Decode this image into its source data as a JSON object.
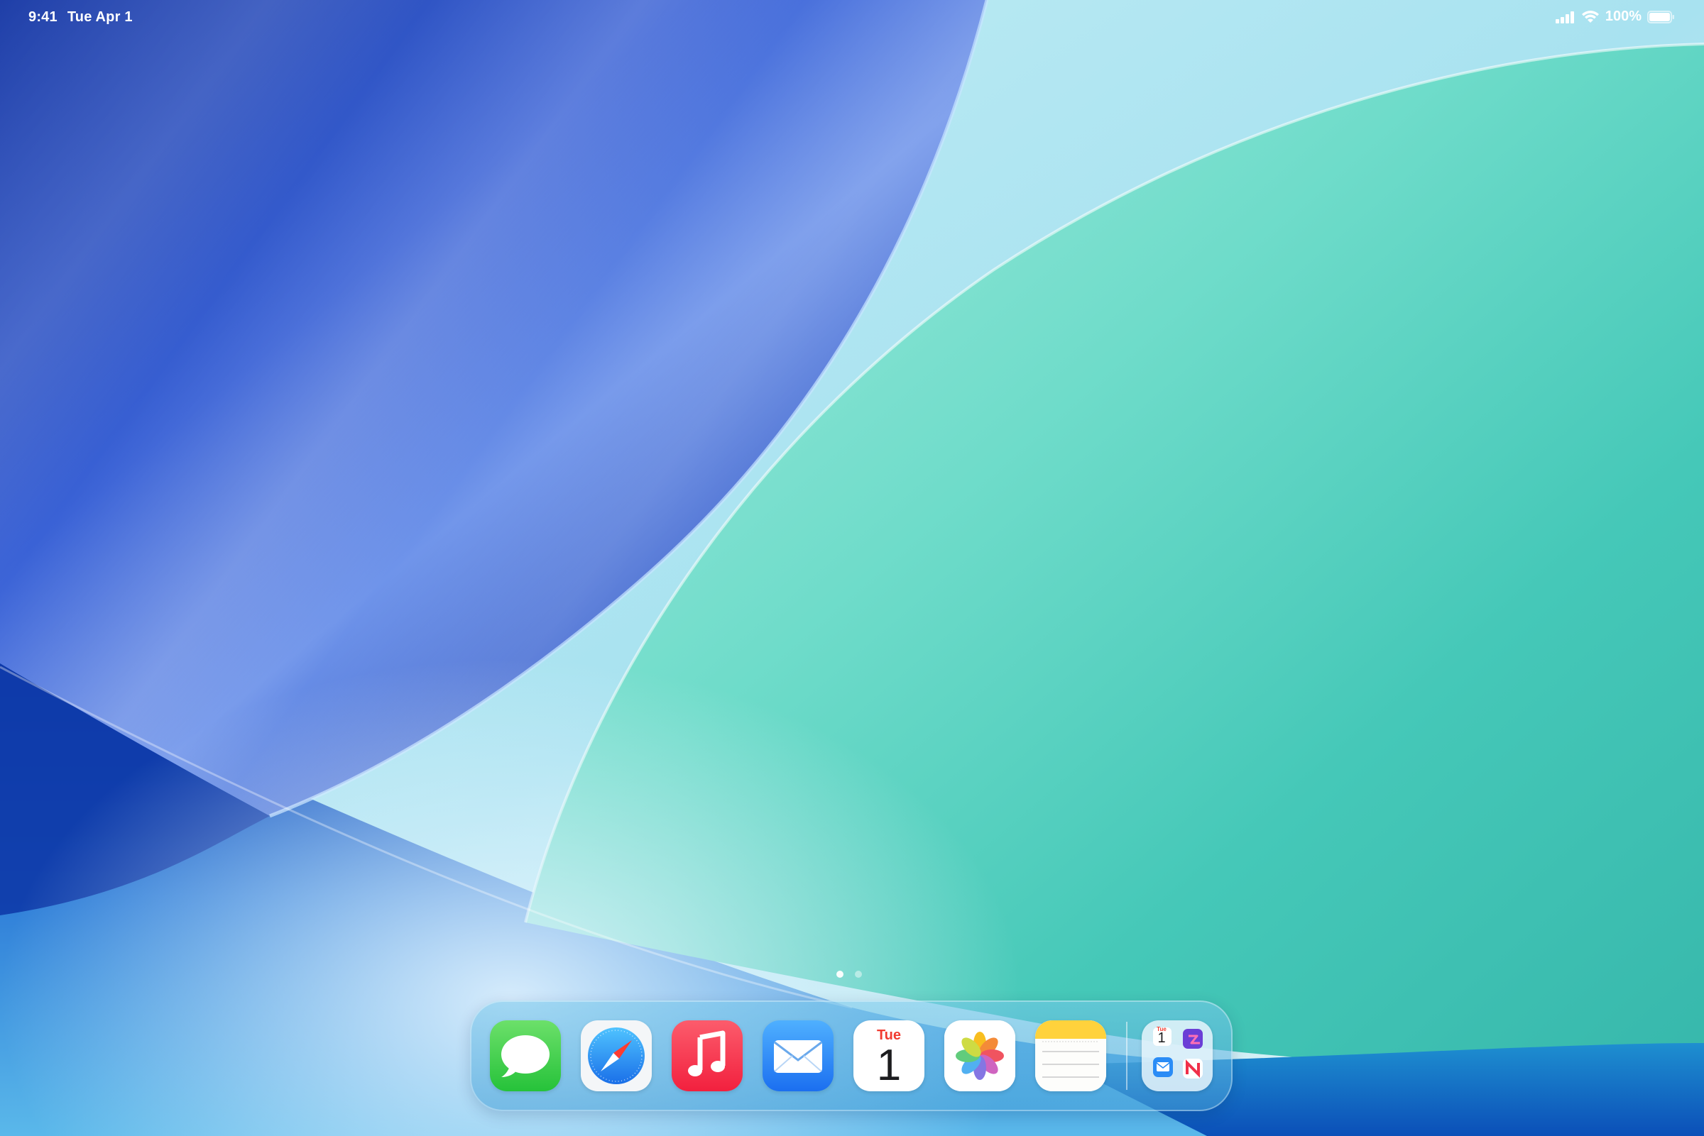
{
  "status_bar": {
    "time": "9:41",
    "date": "Tue Apr 1",
    "battery_percent": "100%",
    "battery_level": 1.0,
    "icons": [
      "cellular-signal-icon",
      "wifi-icon",
      "battery-icon"
    ]
  },
  "home_screen": {
    "page_count": 2,
    "current_page": 1
  },
  "dock": {
    "apps": [
      {
        "name": "Messages",
        "icon": "messages-icon"
      },
      {
        "name": "Safari",
        "icon": "safari-icon"
      },
      {
        "name": "Music",
        "icon": "music-icon"
      },
      {
        "name": "Mail",
        "icon": "mail-icon"
      },
      {
        "name": "Calendar",
        "icon": "calendar-icon",
        "day_label": "Tue",
        "date_label": "1"
      },
      {
        "name": "Photos",
        "icon": "photos-icon"
      },
      {
        "name": "Notes",
        "icon": "notes-icon"
      }
    ],
    "app_library": {
      "icon": "app-library-icon",
      "mini_day": "Tue",
      "mini_date": "1"
    }
  },
  "colors": {
    "wallpaper_blue": "#2a56c8",
    "wallpaper_teal": "#5fd4c4",
    "wallpaper_sky": "#a8e2f0",
    "messages_green": "#3ccf4e",
    "safari_blue": "#1e88f0",
    "music_red": "#fa2f48",
    "mail_blue": "#2a8cf6",
    "calendar_red": "#f13b30",
    "notes_yellow": "#ffd23c"
  }
}
